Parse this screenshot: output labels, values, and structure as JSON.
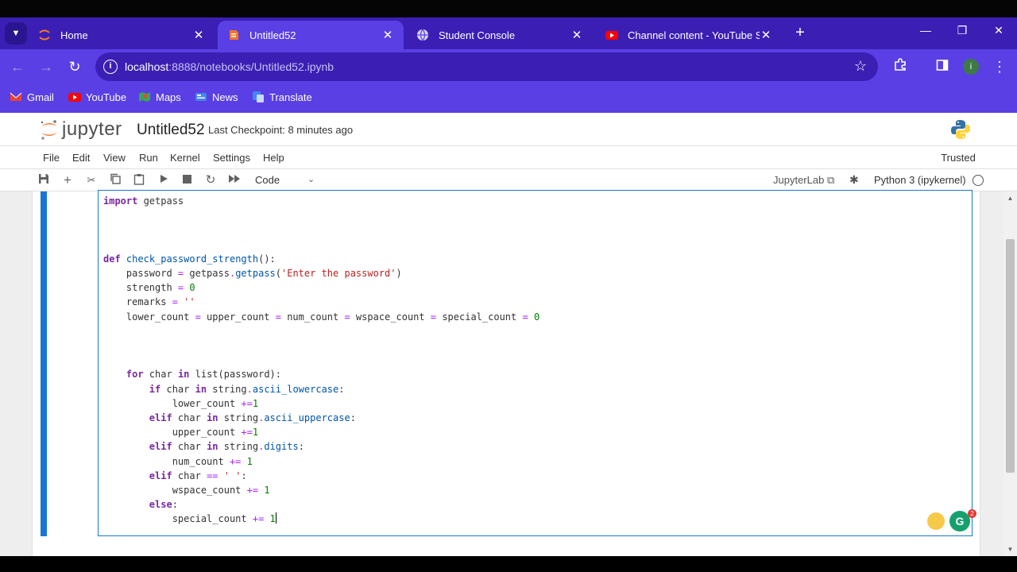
{
  "browser": {
    "tabs": [
      {
        "title": "Home",
        "icon": "jupyter-favicon",
        "active": false
      },
      {
        "title": "Untitled52",
        "icon": "notebook-favicon",
        "active": true
      },
      {
        "title": "Student Console",
        "icon": "globe-favicon",
        "active": false
      },
      {
        "title": "Channel content - YouTube Stu",
        "icon": "youtube-favicon",
        "active": false
      }
    ],
    "url_host": "localhost",
    "url_path": ":8888/notebooks/Untitled52.ipynb",
    "profile_initial": "i",
    "bookmarks": [
      {
        "label": "Gmail",
        "icon": "gmail-icon"
      },
      {
        "label": "YouTube",
        "icon": "youtube-icon"
      },
      {
        "label": "Maps",
        "icon": "maps-icon"
      },
      {
        "label": "News",
        "icon": "news-icon"
      },
      {
        "label": "Translate",
        "icon": "translate-icon"
      }
    ]
  },
  "jupyter": {
    "logo_text": "jupyter",
    "notebook_title": "Untitled52",
    "checkpoint": "Last Checkpoint: 8 minutes ago",
    "menu": [
      "File",
      "Edit",
      "View",
      "Run",
      "Kernel",
      "Settings",
      "Help"
    ],
    "trusted": "Trusted",
    "cell_type": "Code",
    "jupyterlab_link": "JupyterLab",
    "kernel_name": "Python 3 (ipykernel)",
    "badge_count": "2"
  },
  "colors": {
    "browser_tabstrip": "#3b1fb4",
    "browser_toolbar": "#5a3fe4",
    "cell_accent": "#1976d2"
  }
}
